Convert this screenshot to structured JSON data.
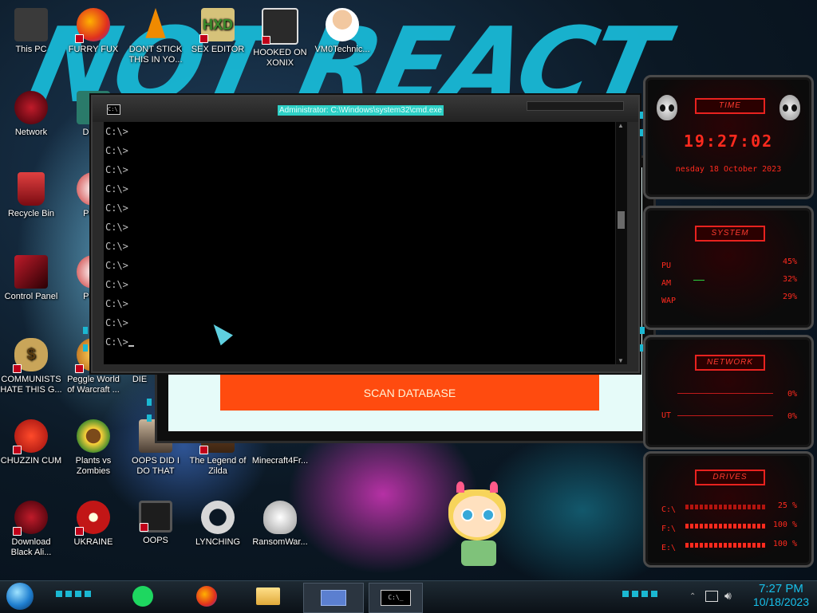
{
  "desktop": {
    "brand_text": "NOT REACT",
    "icons": [
      {
        "label": "This PC",
        "color": "#3a3a3a"
      },
      {
        "label": "FURRY FUX",
        "color": "#e86a12"
      },
      {
        "label": "DONT STICK THIS IN YO...",
        "color": "#f08a00"
      },
      {
        "label": "SEX EDITOR",
        "color": "#c9b15a"
      },
      {
        "label": "HOOKED ON XONIX",
        "color": "#2a2a2a"
      },
      {
        "label": "VM0Technic...",
        "color": "#e9c9a6"
      },
      {
        "label": "Network",
        "color": "#8a0d18"
      },
      {
        "label": "Recycle Bin",
        "color": "#b22222"
      },
      {
        "label": "Control Panel",
        "color": "#9a1b25"
      },
      {
        "label": "COMMUNISTS HATE THIS G...",
        "color": "#d8b86a"
      },
      {
        "label": "Peggle World of Warcraft ...",
        "color": "#2466a8"
      },
      {
        "label": "DIE",
        "color": "#444"
      },
      {
        "label": "CHUZZIN CUM",
        "color": "#d62a1b"
      },
      {
        "label": "Plants vs Zombies",
        "color": "#4c8f2e"
      },
      {
        "label": "OOPS DID I DO THAT",
        "color": "#6a6a6a"
      },
      {
        "label": "The Legend of Zilda",
        "color": "#7a4a26"
      },
      {
        "label": "Minecraft4Fr...",
        "color": "#5b8c3a"
      },
      {
        "label": "Download Black Ali...",
        "color": "#8a0d18"
      },
      {
        "label": "UKRAINE",
        "color": "#c21616"
      },
      {
        "label": "OOPS",
        "color": "#2b2b2b"
      },
      {
        "label": "LYNCHING",
        "color": "#d7d7d7"
      },
      {
        "label": "RansomWar...",
        "color": "#cfcfcf"
      },
      {
        "label": "D DU",
        "color": "#2a7a6a"
      },
      {
        "label": "Pegg",
        "color": "#a33"
      },
      {
        "label": "Pegg",
        "color": "#a33"
      }
    ]
  },
  "scan_window": {
    "button_label": "SCAN DATABASE"
  },
  "cmd_window": {
    "title": "Administrator: C:\\Windows\\system32\\cmd.exe",
    "icon_text": "C:\\",
    "lines": [
      "C:\\>",
      "C:\\>",
      "C:\\>",
      "C:\\>",
      "C:\\>",
      "C:\\>",
      "C:\\>",
      "C:\\>",
      "C:\\>",
      "C:\\>",
      "C:\\>",
      "C:\\>"
    ]
  },
  "gadgets": {
    "time": {
      "title": "TIME",
      "clock": "19:27:02",
      "date": "nesday 18 October 2023"
    },
    "system": {
      "title": "SYSTEM",
      "rows": [
        {
          "label": "PU",
          "value": "45%"
        },
        {
          "label": "AM",
          "value": "32%"
        },
        {
          "label": "WAP",
          "value": "29%"
        }
      ]
    },
    "network": {
      "title": "NETWORK",
      "rows": [
        {
          "label": "",
          "value": "0%"
        },
        {
          "label": "UT",
          "value": "0%"
        }
      ]
    },
    "drives": {
      "title": "DRIVES",
      "rows": [
        {
          "label": "C:\\",
          "value": "25 %"
        },
        {
          "label": "F:\\",
          "value": "100 %"
        },
        {
          "label": "E:\\",
          "value": "100 %"
        }
      ]
    }
  },
  "taskbar": {
    "tray_icons": [
      "network-icon",
      "volume-icon"
    ],
    "clock_time": "7:27 PM",
    "clock_date": "10/18/2023"
  }
}
